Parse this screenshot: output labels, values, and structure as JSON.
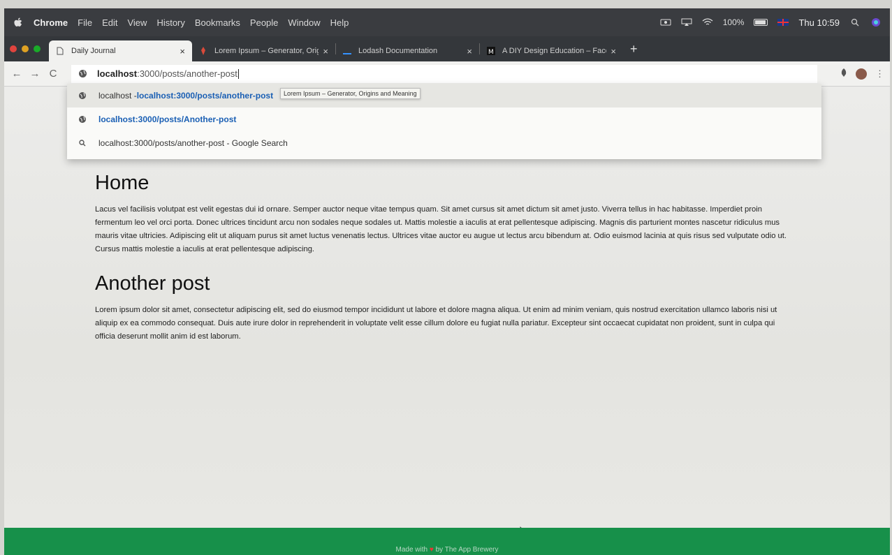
{
  "menubar": {
    "app": "Chrome",
    "items": [
      "File",
      "Edit",
      "View",
      "History",
      "Bookmarks",
      "People",
      "Window",
      "Help"
    ],
    "battery": "100%",
    "clock": "Thu 10:59"
  },
  "tabs": [
    {
      "title": "Daily Journal",
      "icon": "document-icon",
      "active": true
    },
    {
      "title": "Lorem Ipsum – Generator, Orig",
      "icon": "lorem-icon",
      "active": false
    },
    {
      "title": "Lodash Documentation",
      "icon": "lodash-icon",
      "active": false
    },
    {
      "title": "A DIY Design Education – Face",
      "icon": "medium-icon",
      "active": false
    }
  ],
  "omnibox": {
    "host": "localhost",
    "path": ":3000/posts/another-post"
  },
  "tooltip": "Lorem Ipsum – Generator, Origins and Meaning",
  "suggestions": [
    {
      "prefix": "localhost - ",
      "url": "localhost:3000/posts/another-post",
      "suffix": "",
      "icon": "globe-icon"
    },
    {
      "prefix": "",
      "url": "localhost:3000/posts/Another-post",
      "suffix": "",
      "icon": "globe-icon"
    },
    {
      "prefix": "localhost:3000/posts/another-post - Google Search",
      "url": "",
      "suffix": "",
      "icon": "search-icon"
    }
  ],
  "posts": [
    {
      "title": "Home",
      "body": "Lacus vel facilisis volutpat est velit egestas dui id ornare. Semper auctor neque vitae tempus quam. Sit amet cursus sit amet dictum sit amet justo. Viverra tellus in hac habitasse. Imperdiet proin fermentum leo vel orci porta. Donec ultrices tincidunt arcu non sodales neque sodales ut. Mattis molestie a iaculis at erat pellentesque adipiscing. Magnis dis parturient montes nascetur ridiculus mus mauris vitae ultricies. Adipiscing elit ut aliquam purus sit amet luctus venenatis lectus. Ultrices vitae auctor eu augue ut lectus arcu bibendum at. Odio euismod lacinia at quis risus sed vulputate odio ut. Cursus mattis molestie a iaculis at erat pellentesque adipiscing."
    },
    {
      "title": "Another post",
      "body": "Lorem ipsum dolor sit amet, consectetur adipiscing elit, sed do eiusmod tempor incididunt ut labore et dolore magna aliqua. Ut enim ad minim veniam, quis nostrud exercitation ullamco laboris nisi ut aliquip ex ea commodo consequat. Duis aute irure dolor in reprehenderit in voluptate velit esse cillum dolore eu fugiat nulla pariatur. Excepteur sint occaecat cupidatat non proident, sunt in culpa qui officia deserunt mollit anim id est laborum."
    }
  ],
  "footer": {
    "prefix": "Made with",
    "suffix": "by The App Brewery"
  },
  "colors": {
    "footer_bg": "#17904a",
    "suggestion_url": "#1a5fb4"
  }
}
